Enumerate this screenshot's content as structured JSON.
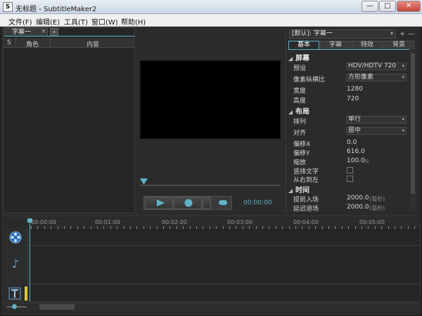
{
  "window": {
    "title": "无标题 - SubtitleMaker2",
    "icon_glyph": "S",
    "minimize": "—",
    "maximize": "□",
    "close": "✕"
  },
  "menu": [
    "文件(F)",
    "编辑(E)",
    "工具(T)",
    "窗口(W)",
    "帮助(H)"
  ],
  "subtitle_list": {
    "tab_label": "字幕一",
    "tab_close": "×",
    "tab_add": "+",
    "columns": [
      "S",
      "角色",
      "内容"
    ]
  },
  "player": {
    "time": "00:00:00",
    "accent": "#5fb3c8"
  },
  "style_panel": {
    "preset": "[默认]: 字幕一",
    "add": "+",
    "remove": "—",
    "tabs": [
      "基本",
      "字幕",
      "特效",
      "背景"
    ],
    "active_tab": "基本",
    "sections": {
      "screen": "屏幕",
      "layout": "布局",
      "time": "时间"
    },
    "props": {
      "preset_label": "预设",
      "preset_value": "HDV/HDTV 720",
      "pixel_ratio_label": "像素纵横比",
      "pixel_ratio_value": "方形像素",
      "width_label": "宽度",
      "width_value": "1280",
      "height_label": "高度",
      "height_value": "720",
      "arrange_label": "排列",
      "arrange_value": "单行",
      "align_label": "对齐",
      "align_value": "居中",
      "offset_x_label": "偏移X",
      "offset_x_value": "0.0",
      "offset_y_label": "偏移Y",
      "offset_y_value": "616.0",
      "scale_label": "缩放",
      "scale_value": "100.0",
      "scale_unit": "%",
      "vertical_label": "竖排文字",
      "rtl_label": "从右到左",
      "lead_in_label": "提前入场",
      "lead_in_value": "2000.0",
      "lead_in_unit": "(毫秒)",
      "lag_out_label": "延迟退场",
      "lag_out_value": "2000.0",
      "lag_out_unit": "(毫秒)"
    }
  },
  "timeline": {
    "ticks": [
      "00:00:00",
      "00:01:00",
      "00:02:00",
      "00:03:00",
      "00:04:00",
      "00:05:00"
    ]
  }
}
